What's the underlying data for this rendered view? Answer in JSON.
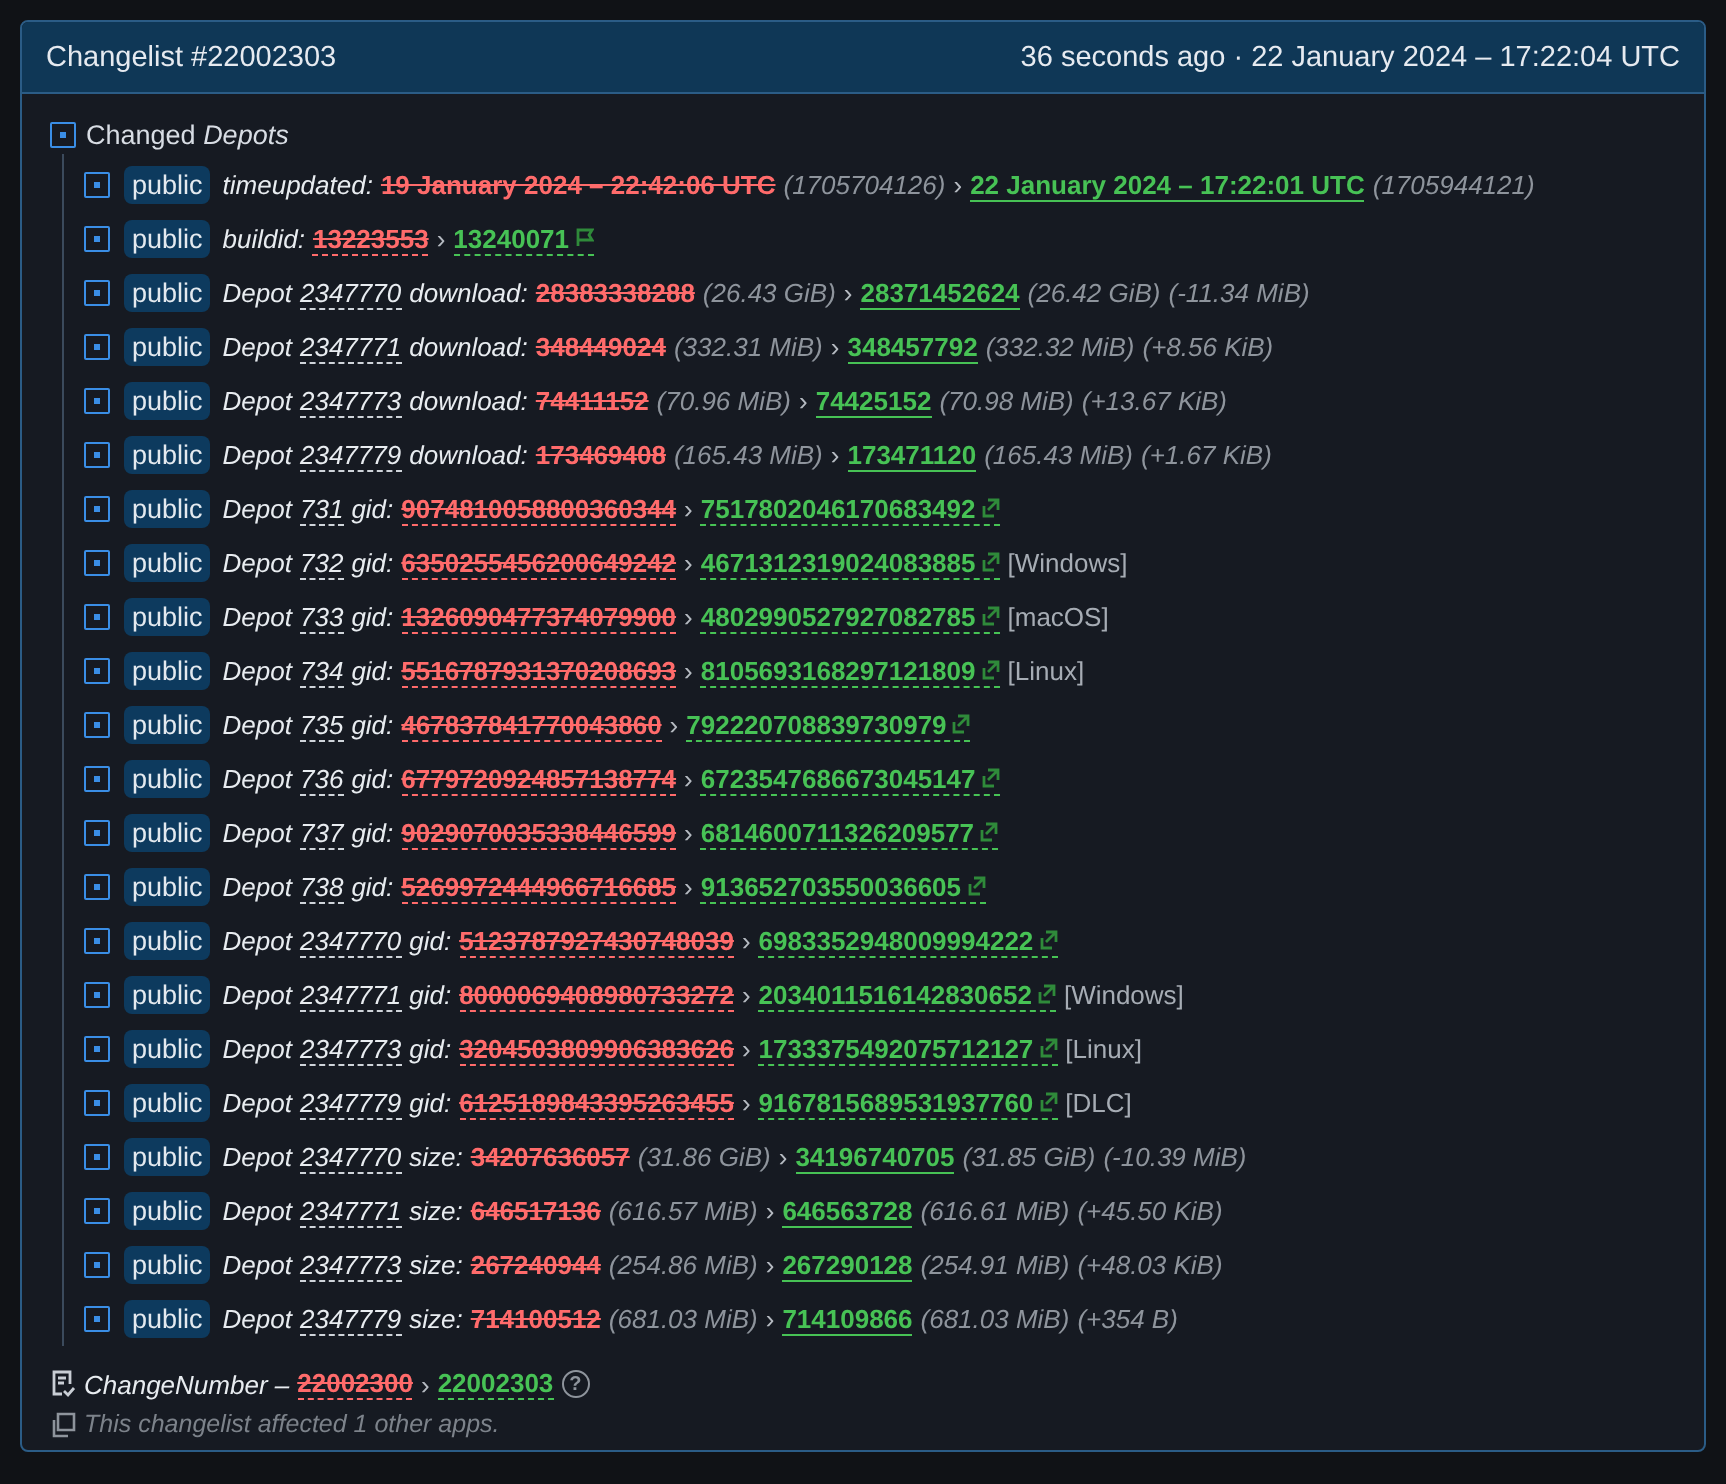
{
  "header": {
    "title": "Changelist #22002303",
    "time": "36 seconds ago · 22 January 2024 – 17:22:04 UTC"
  },
  "section": {
    "title": "Changed *Depots*",
    "expanded": true
  },
  "rows": [
    {
      "kind": "time",
      "badge": "public",
      "field": "timeupdated:",
      "old": "19 January 2024 – 22:42:06 UTC",
      "old_note": "(1705704126)",
      "arrow": "›",
      "new": "22 January 2024 – 17:22:01 UTC",
      "new_note": "(1705944121)"
    },
    {
      "kind": "build",
      "badge": "public",
      "field": "buildid:",
      "old": "13223553",
      "arrow": "›",
      "new": "13240071"
    },
    {
      "kind": "size",
      "badge": "public",
      "prefix": "Depot",
      "depot": "2347770",
      "field": "download:",
      "old": "28383338288",
      "old_note": "(26.43 GiB)",
      "arrow": "›",
      "new": "28371452624",
      "new_note": "(26.42 GiB)",
      "diff": "(-11.34 MiB)"
    },
    {
      "kind": "size",
      "badge": "public",
      "prefix": "Depot",
      "depot": "2347771",
      "field": "download:",
      "old": "348449024",
      "old_note": "(332.31 MiB)",
      "arrow": "›",
      "new": "348457792",
      "new_note": "(332.32 MiB)",
      "diff": "(+8.56 KiB)"
    },
    {
      "kind": "size",
      "badge": "public",
      "prefix": "Depot",
      "depot": "2347773",
      "field": "download:",
      "old": "74411152",
      "old_note": "(70.96 MiB)",
      "arrow": "›",
      "new": "74425152",
      "new_note": "(70.98 MiB)",
      "diff": "(+13.67 KiB)"
    },
    {
      "kind": "size",
      "badge": "public",
      "prefix": "Depot",
      "depot": "2347779",
      "field": "download:",
      "old": "173469408",
      "old_note": "(165.43 MiB)",
      "arrow": "›",
      "new": "173471120",
      "new_note": "(165.43 MiB)",
      "diff": "(+1.67 KiB)"
    },
    {
      "kind": "gid",
      "badge": "public",
      "prefix": "Depot",
      "depot": "731",
      "field": "gid:",
      "old": "9074810058800360344",
      "arrow": "›",
      "new": "7517802046170683492"
    },
    {
      "kind": "gid",
      "badge": "public",
      "prefix": "Depot",
      "depot": "732",
      "field": "gid:",
      "old": "6350255456200649242",
      "arrow": "›",
      "new": "4671312319024083885",
      "tag": "[Windows]"
    },
    {
      "kind": "gid",
      "badge": "public",
      "prefix": "Depot",
      "depot": "733",
      "field": "gid:",
      "old": "1326090477374079900",
      "arrow": "›",
      "new": "4802990527927082785",
      "tag": "[macOS]"
    },
    {
      "kind": "gid",
      "badge": "public",
      "prefix": "Depot",
      "depot": "734",
      "field": "gid:",
      "old": "5516787931370208693",
      "arrow": "›",
      "new": "8105693168297121809",
      "tag": "[Linux]"
    },
    {
      "kind": "gid",
      "badge": "public",
      "prefix": "Depot",
      "depot": "735",
      "field": "gid:",
      "old": "467837841770043860",
      "arrow": "›",
      "new": "792220708839730979"
    },
    {
      "kind": "gid",
      "badge": "public",
      "prefix": "Depot",
      "depot": "736",
      "field": "gid:",
      "old": "6779720924857138774",
      "arrow": "›",
      "new": "6723547686673045147"
    },
    {
      "kind": "gid",
      "badge": "public",
      "prefix": "Depot",
      "depot": "737",
      "field": "gid:",
      "old": "9029070035338446599",
      "arrow": "›",
      "new": "6814600711326209577"
    },
    {
      "kind": "gid",
      "badge": "public",
      "prefix": "Depot",
      "depot": "738",
      "field": "gid:",
      "old": "5269972444966716685",
      "arrow": "›",
      "new": "913652703550036605"
    },
    {
      "kind": "gid",
      "badge": "public",
      "prefix": "Depot",
      "depot": "2347770",
      "field": "gid:",
      "old": "5123787927430748039",
      "arrow": "›",
      "new": "6983352948009994222"
    },
    {
      "kind": "gid",
      "badge": "public",
      "prefix": "Depot",
      "depot": "2347771",
      "field": "gid:",
      "old": "8000069408980733272",
      "arrow": "›",
      "new": "2034011516142830652",
      "tag": "[Windows]"
    },
    {
      "kind": "gid",
      "badge": "public",
      "prefix": "Depot",
      "depot": "2347773",
      "field": "gid:",
      "old": "3204503809906383626",
      "arrow": "›",
      "new": "1733375492075712127",
      "tag": "[Linux]"
    },
    {
      "kind": "gid",
      "badge": "public",
      "prefix": "Depot",
      "depot": "2347779",
      "field": "gid:",
      "old": "6125189843395263455",
      "arrow": "›",
      "new": "9167815689531937760",
      "tag": "[DLC]"
    },
    {
      "kind": "size",
      "badge": "public",
      "prefix": "Depot",
      "depot": "2347770",
      "field": "size:",
      "old": "34207636057",
      "old_note": "(31.86 GiB)",
      "arrow": "›",
      "new": "34196740705",
      "new_note": "(31.85 GiB)",
      "diff": "(-10.39 MiB)"
    },
    {
      "kind": "size",
      "badge": "public",
      "prefix": "Depot",
      "depot": "2347771",
      "field": "size:",
      "old": "646517136",
      "old_note": "(616.57 MiB)",
      "arrow": "›",
      "new": "646563728",
      "new_note": "(616.61 MiB)",
      "diff": "(+45.50 KiB)"
    },
    {
      "kind": "size",
      "badge": "public",
      "prefix": "Depot",
      "depot": "2347773",
      "field": "size:",
      "old": "267240944",
      "old_note": "(254.86 MiB)",
      "arrow": "›",
      "new": "267290128",
      "new_note": "(254.91 MiB)",
      "diff": "(+48.03 KiB)"
    },
    {
      "kind": "size",
      "badge": "public",
      "prefix": "Depot",
      "depot": "2347779",
      "field": "size:",
      "old": "714100512",
      "old_note": "(681.03 MiB)",
      "arrow": "›",
      "new": "714109866",
      "new_note": "(681.03 MiB)",
      "diff": "(+354 B)"
    }
  ],
  "change_number": {
    "label": "ChangeNumber –",
    "old": "22002300",
    "arrow": "›",
    "new": "22002303",
    "help": "?"
  },
  "note": "This changelist affected 1 other apps."
}
